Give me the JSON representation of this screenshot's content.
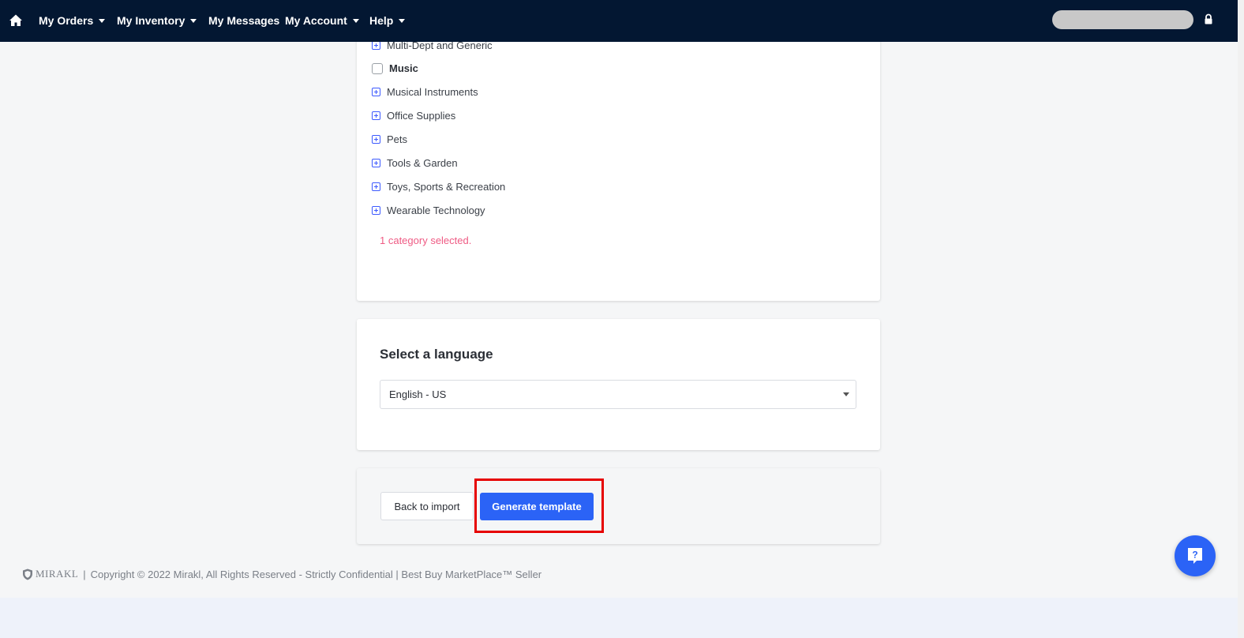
{
  "navbar": {
    "items": [
      {
        "label": "My Orders",
        "has_dropdown": true
      },
      {
        "label": "My Inventory",
        "has_dropdown": true
      },
      {
        "label": "My Messages",
        "has_dropdown": false
      },
      {
        "label": "My Account",
        "has_dropdown": true
      },
      {
        "label": "Help",
        "has_dropdown": true
      }
    ],
    "icons": {
      "home": "home-icon",
      "lock": "lock-icon"
    }
  },
  "categories": {
    "items": [
      {
        "label": "Multi-Dept and Generic",
        "control": "expand"
      },
      {
        "label": "Music",
        "control": "checkbox",
        "checked": false
      },
      {
        "label": "Musical Instruments",
        "control": "expand"
      },
      {
        "label": "Office Supplies",
        "control": "expand"
      },
      {
        "label": "Pets",
        "control": "expand"
      },
      {
        "label": "Tools & Garden",
        "control": "expand"
      },
      {
        "label": "Toys, Sports & Recreation",
        "control": "expand"
      },
      {
        "label": "Wearable Technology",
        "control": "expand"
      }
    ],
    "selected_note": "1 category selected."
  },
  "language": {
    "title": "Select a language",
    "selected": "English - US"
  },
  "actions": {
    "back_label": "Back to import",
    "generate_label": "Generate template"
  },
  "footer": {
    "brand": "MIRAKL",
    "separator": "|",
    "copyright": "Copyright © 2022 Mirakl, All Rights Reserved - Strictly Confidential | Best Buy MarketPlace™ Seller"
  },
  "help_fab": {
    "icon": "help-question-icon"
  },
  "colors": {
    "navbar": "#031732",
    "primary": "#2b63f6",
    "note": "#ef5b84",
    "highlight": "#e60000"
  }
}
